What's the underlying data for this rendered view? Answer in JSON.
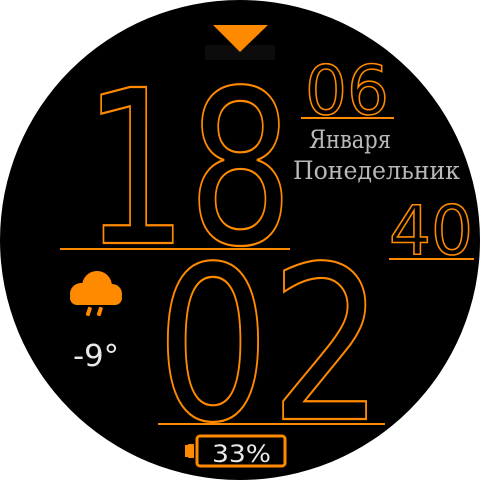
{
  "colors": {
    "accent": "#ff8a00",
    "background": "#000000",
    "secondary_text": "#b9b9b9"
  },
  "time": {
    "hour": "18",
    "minute": "02",
    "seconds": "40"
  },
  "date": {
    "day": "06",
    "month": "Января",
    "weekday": "Понедельник"
  },
  "weather": {
    "icon": "cloud-rain-icon",
    "temperature": "-9°"
  },
  "battery": {
    "level_text": "33%",
    "level": 0.33,
    "icon": "battery-icon"
  },
  "controls": {
    "expand_icon": "chevron-down-icon"
  }
}
